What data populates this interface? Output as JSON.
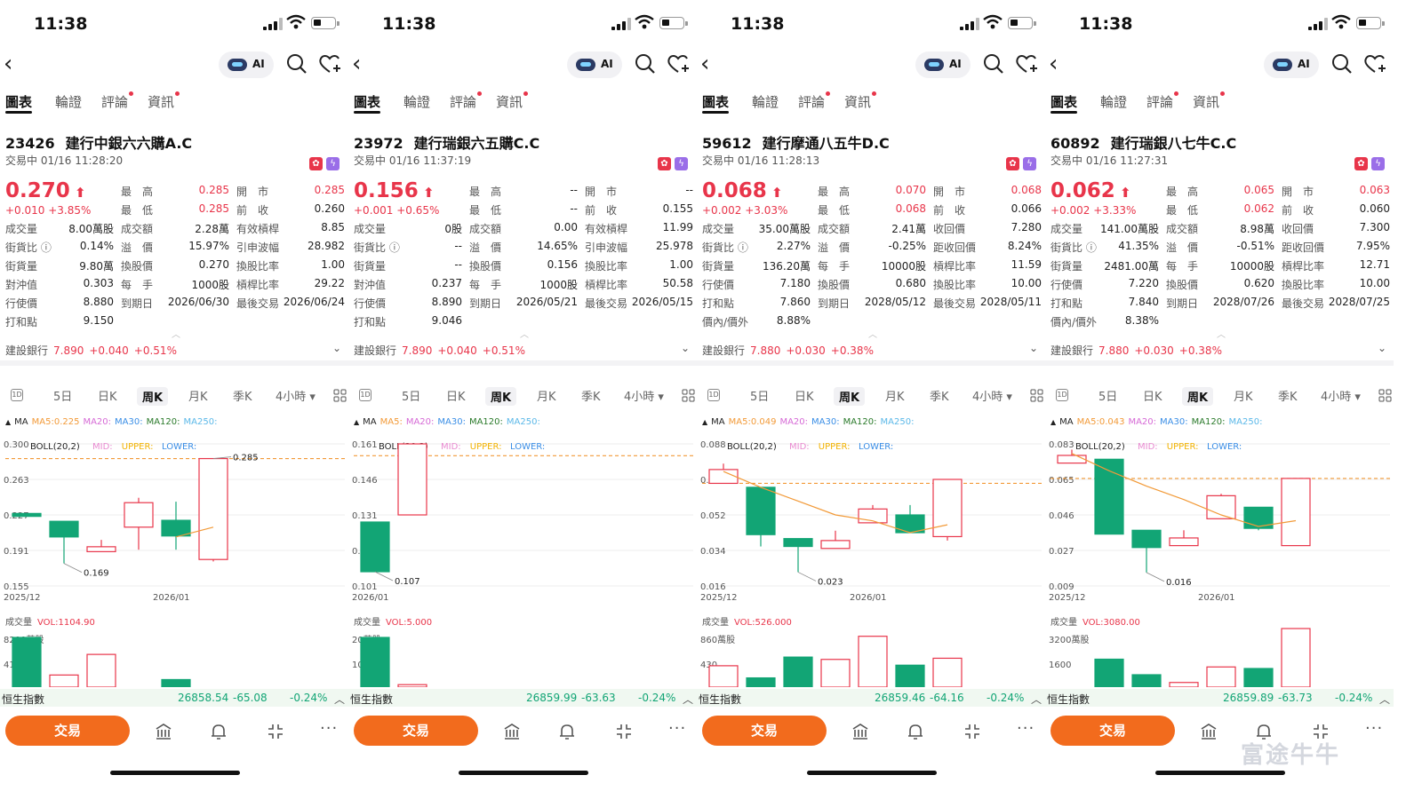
{
  "screens": [
    {
      "time": "11:38",
      "tabs": [
        "圖表",
        "輪證",
        "評論",
        "資訊"
      ],
      "code": "23426",
      "name": "建行中銀六六購A.C",
      "status": "交易中 01/16 11:28:20",
      "price": "0.270",
      "change": "+0.010 +3.85%",
      "quote_rows": [
        [
          "最　高",
          "0.285",
          "開　市",
          "0.285"
        ],
        [
          "最　低",
          "0.285",
          "前　收",
          "0.260"
        ],
        [
          "成交額",
          "2.28萬",
          "有效槓桿",
          "8.85"
        ],
        [
          "溢　價",
          "15.97%",
          "引申波幅",
          "28.982"
        ],
        [
          "換股價",
          "0.270",
          "換股比率",
          "1.00"
        ],
        [
          "每　手",
          "1000股",
          "槓桿比率",
          "29.22"
        ],
        [
          "到期日",
          "2026/06/30",
          "最後交易",
          "2026/06/24"
        ]
      ],
      "left_rows": [
        [
          "成交量",
          "8.00萬股"
        ],
        [
          "街貨比",
          "0.14%"
        ],
        [
          "街貨量",
          "9.80萬"
        ],
        [
          "對沖值",
          "0.303"
        ],
        [
          "行使價",
          "8.880"
        ],
        [
          "打和點",
          "9.150"
        ]
      ],
      "underlying": {
        "name": "建設銀行",
        "price": "7.890",
        "change": "+0.040",
        "pct": "+0.51%"
      },
      "periods": [
        "5日",
        "日K",
        "周K",
        "月K",
        "季K",
        "4小時"
      ],
      "ma_label": "MA",
      "ma_items": [
        [
          "MA5:0.225",
          "#f29a38"
        ],
        [
          "MA20:",
          "#d66ad6"
        ],
        [
          "MA30:",
          "#3a8ee6"
        ],
        [
          "MA120:",
          "#2a7a2a"
        ],
        [
          "MA250:",
          "#5bb8e8"
        ]
      ],
      "boll_items": [
        [
          "BOLL(20,2)",
          "#222"
        ],
        [
          "MID:",
          "#e88ad0"
        ],
        [
          "UPPER:",
          "#f2b200"
        ],
        [
          "LOWER:",
          "#3a8ee6"
        ]
      ],
      "chart_data": {
        "type": "candlestick",
        "y_ticks": [
          "0.300",
          "0.263",
          "0.227",
          "0.191",
          "0.155"
        ],
        "y_range": [
          0.155,
          0.3
        ],
        "x_labels": [
          "2025/12",
          "2026/01"
        ],
        "ref_line": 0.285,
        "candles": [
          {
            "o": 0.229,
            "c": 0.226,
            "h": 0.229,
            "l": 0.226,
            "up": false
          },
          {
            "o": 0.221,
            "c": 0.205,
            "h": 0.221,
            "l": 0.178,
            "up": false
          },
          {
            "o": 0.19,
            "c": 0.195,
            "h": 0.202,
            "l": 0.19,
            "up": true
          },
          {
            "o": 0.215,
            "c": 0.24,
            "h": 0.245,
            "l": 0.192,
            "up": true
          },
          {
            "o": 0.222,
            "c": 0.206,
            "h": 0.241,
            "l": 0.192,
            "up": false
          },
          {
            "o": 0.182,
            "c": 0.285,
            "h": 0.285,
            "l": 0.18,
            "up": true
          }
        ],
        "annotations": [
          {
            "candle": 5,
            "value": "0.285",
            "pos": "high"
          },
          {
            "candle": 1,
            "value": "0.169",
            "pos": "low"
          }
        ],
        "ma5": [
          null,
          null,
          null,
          null,
          0.205,
          0.215
        ]
      },
      "vol_label": "成交量",
      "vol_value": "VOL:1104.90",
      "vol_ticks": [
        "8200萬股",
        "4100"
      ],
      "volume": {
        "max": 8200,
        "bars": [
          [
            8200,
            false
          ],
          [
            2000,
            true
          ],
          [
            5400,
            true
          ],
          [
            0,
            false
          ],
          [
            1250,
            false
          ],
          [
            0,
            false
          ]
        ]
      },
      "hsi": {
        "name": "恒生指數",
        "value": "26858.54",
        "change": "-65.08",
        "pct": "-0.24%"
      },
      "trade_label": "交易"
    },
    {
      "time": "11:38",
      "tabs": [
        "圖表",
        "輪證",
        "評論",
        "資訊"
      ],
      "code": "23972",
      "name": "建行瑞銀六五購C.C",
      "status": "交易中 01/16 11:37:19",
      "price": "0.156",
      "change": "+0.001 +0.65%",
      "quote_rows": [
        [
          "最　高",
          "--",
          "開　市",
          "--"
        ],
        [
          "最　低",
          "--",
          "前　收",
          "0.155"
        ],
        [
          "成交額",
          "0.00",
          "有效槓桿",
          "11.99"
        ],
        [
          "溢　價",
          "14.65%",
          "引申波幅",
          "25.978"
        ],
        [
          "換股價",
          "0.156",
          "換股比率",
          "1.00"
        ],
        [
          "每　手",
          "1000股",
          "槓桿比率",
          "50.58"
        ],
        [
          "到期日",
          "2026/05/21",
          "最後交易",
          "2026/05/15"
        ]
      ],
      "left_rows": [
        [
          "成交量",
          "0股"
        ],
        [
          "街貨比",
          "--"
        ],
        [
          "街貨量",
          "--"
        ],
        [
          "對沖值",
          "0.237"
        ],
        [
          "行使價",
          "8.890"
        ],
        [
          "打和點",
          "9.046"
        ]
      ],
      "underlying": {
        "name": "建設銀行",
        "price": "7.890",
        "change": "+0.040",
        "pct": "+0.51%"
      },
      "periods": [
        "5日",
        "日K",
        "周K",
        "月K",
        "季K",
        "4小時"
      ],
      "ma_label": "MA",
      "ma_items": [
        [
          "MA5:",
          "#f29a38"
        ],
        [
          "MA20:",
          "#d66ad6"
        ],
        [
          "MA30:",
          "#3a8ee6"
        ],
        [
          "MA120:",
          "#2a7a2a"
        ],
        [
          "MA250:",
          "#5bb8e8"
        ]
      ],
      "boll_items": [
        [
          "BOLL(20,2)",
          "#222"
        ],
        [
          "MID:",
          "#e88ad0"
        ],
        [
          "UPPER:",
          "#f2b200"
        ],
        [
          "LOWER:",
          "#3a8ee6"
        ]
      ],
      "chart_data": {
        "type": "candlestick",
        "y_ticks": [
          "0.161",
          "0.146",
          "0.131",
          "0.116",
          "0.101"
        ],
        "y_range": [
          0.101,
          0.161
        ],
        "x_labels": [
          "2026/01"
        ],
        "ref_line": 0.156,
        "candles": [
          {
            "o": 0.128,
            "c": 0.107,
            "h": 0.128,
            "l": 0.107,
            "up": false
          },
          {
            "o": 0.131,
            "c": 0.161,
            "h": 0.161,
            "l": 0.131,
            "up": true
          }
        ],
        "annotations": [
          {
            "candle": 0,
            "value": "0.107",
            "pos": "low"
          }
        ],
        "ma5": []
      },
      "vol_label": "成交量",
      "vol_value": "VOL:5.000",
      "vol_ticks": [
        "20萬股",
        "10"
      ],
      "volume": {
        "max": 20,
        "bars": [
          [
            20,
            false
          ],
          [
            1,
            true
          ]
        ]
      },
      "hsi": {
        "name": "恒生指數",
        "value": "26859.99",
        "change": "-63.63",
        "pct": "-0.24%"
      },
      "trade_label": "交易"
    },
    {
      "time": "11:38",
      "tabs": [
        "圖表",
        "輪證",
        "評論",
        "資訊"
      ],
      "code": "59612",
      "name": "建行摩通八五牛D.C",
      "status": "交易中 01/16 11:28:13",
      "price": "0.068",
      "change": "+0.002 +3.03%",
      "quote_rows": [
        [
          "最　高",
          "0.070",
          "開　市",
          "0.068"
        ],
        [
          "最　低",
          "0.068",
          "前　收",
          "0.066"
        ],
        [
          "成交額",
          "2.41萬",
          "收回價",
          "7.280"
        ],
        [
          "溢　價",
          "-0.25%",
          "距收回價",
          "8.24%"
        ],
        [
          "每　手",
          "10000股",
          "槓桿比率",
          "11.59"
        ],
        [
          "換股價",
          "0.680",
          "換股比率",
          "10.00"
        ],
        [
          "到期日",
          "2028/05/12",
          "最後交易",
          "2028/05/11"
        ]
      ],
      "left_rows": [
        [
          "成交量",
          "35.00萬股"
        ],
        [
          "街貨比",
          "2.27%"
        ],
        [
          "街貨量",
          "136.20萬"
        ],
        [
          "行使價",
          "7.180"
        ],
        [
          "打和點",
          "7.860"
        ],
        [
          "價內/價外",
          "8.88%"
        ]
      ],
      "underlying": {
        "name": "建設銀行",
        "price": "7.880",
        "change": "+0.030",
        "pct": "+0.38%"
      },
      "periods": [
        "5日",
        "日K",
        "周K",
        "月K",
        "季K",
        "4小時"
      ],
      "ma_label": "MA",
      "ma_items": [
        [
          "MA5:0.049",
          "#f29a38"
        ],
        [
          "MA20:",
          "#d66ad6"
        ],
        [
          "MA30:",
          "#3a8ee6"
        ],
        [
          "MA120:",
          "#2a7a2a"
        ],
        [
          "MA250:",
          "#5bb8e8"
        ]
      ],
      "boll_items": [
        [
          "BOLL(20,2)",
          "#222"
        ],
        [
          "MID:",
          "#e88ad0"
        ],
        [
          "UPPER:",
          "#f2b200"
        ],
        [
          "LOWER:",
          "#3a8ee6"
        ]
      ],
      "chart_data": {
        "type": "candlestick",
        "y_ticks": [
          "0.088",
          "0.070",
          "0.052",
          "0.034",
          "0.016"
        ],
        "y_range": [
          0.016,
          0.088
        ],
        "x_labels": [
          "2025/12",
          "2026/01"
        ],
        "ref_line": 0.068,
        "candles": [
          {
            "o": 0.068,
            "c": 0.075,
            "h": 0.078,
            "l": 0.068,
            "up": true
          },
          {
            "o": 0.066,
            "c": 0.042,
            "h": 0.066,
            "l": 0.036,
            "up": false
          },
          {
            "o": 0.04,
            "c": 0.036,
            "h": 0.04,
            "l": 0.023,
            "up": false
          },
          {
            "o": 0.035,
            "c": 0.039,
            "h": 0.044,
            "l": 0.035,
            "up": true
          },
          {
            "o": 0.048,
            "c": 0.055,
            "h": 0.057,
            "l": 0.048,
            "up": true
          },
          {
            "o": 0.052,
            "c": 0.043,
            "h": 0.057,
            "l": 0.043,
            "up": false
          },
          {
            "o": 0.041,
            "c": 0.07,
            "h": 0.07,
            "l": 0.039,
            "up": true
          }
        ],
        "annotations": [
          {
            "candle": 2,
            "value": "0.023",
            "pos": "low"
          }
        ],
        "ma5": [
          0.074,
          0.066,
          0.059,
          0.052,
          0.049,
          0.043,
          0.047
        ]
      },
      "vol_label": "成交量",
      "vol_value": "VOL:526.000",
      "vol_ticks": [
        "860萬股",
        "430"
      ],
      "volume": {
        "max": 860,
        "bars": [
          [
            370,
            true
          ],
          [
            160,
            false
          ],
          [
            520,
            false
          ],
          [
            480,
            true
          ],
          [
            880,
            true
          ],
          [
            380,
            false
          ],
          [
            500,
            true
          ]
        ]
      },
      "hsi": {
        "name": "恒生指數",
        "value": "26859.46",
        "change": "-64.16",
        "pct": "-0.24%"
      },
      "trade_label": "交易"
    },
    {
      "time": "11:38",
      "tabs": [
        "圖表",
        "輪證",
        "評論",
        "資訊"
      ],
      "code": "60892",
      "name": "建行瑞銀八七牛C.C",
      "status": "交易中 01/16 11:27:31",
      "price": "0.062",
      "change": "+0.002 +3.33%",
      "quote_rows": [
        [
          "最　高",
          "0.065",
          "開　市",
          "0.063"
        ],
        [
          "最　低",
          "0.062",
          "前　收",
          "0.060"
        ],
        [
          "成交額",
          "8.98萬",
          "收回價",
          "7.300"
        ],
        [
          "溢　價",
          "-0.51%",
          "距收回價",
          "7.95%"
        ],
        [
          "每　手",
          "10000股",
          "槓桿比率",
          "12.71"
        ],
        [
          "換股價",
          "0.620",
          "換股比率",
          "10.00"
        ],
        [
          "到期日",
          "2028/07/26",
          "最後交易",
          "2028/07/25"
        ]
      ],
      "left_rows": [
        [
          "成交量",
          "141.00萬股"
        ],
        [
          "街貨比",
          "41.35%"
        ],
        [
          "街貨量",
          "2481.00萬"
        ],
        [
          "行使價",
          "7.220"
        ],
        [
          "打和點",
          "7.840"
        ],
        [
          "價內/價外",
          "8.38%"
        ]
      ],
      "underlying": {
        "name": "建設銀行",
        "price": "7.880",
        "change": "+0.030",
        "pct": "+0.38%"
      },
      "periods": [
        "5日",
        "日K",
        "周K",
        "月K",
        "季K",
        "4小時"
      ],
      "ma_label": "MA",
      "ma_items": [
        [
          "MA5:0.043",
          "#f29a38"
        ],
        [
          "MA20:",
          "#d66ad6"
        ],
        [
          "MA30:",
          "#3a8ee6"
        ],
        [
          "MA120:",
          "#2a7a2a"
        ],
        [
          "MA250:",
          "#5bb8e8"
        ]
      ],
      "boll_items": [
        [
          "BOLL(20,2)",
          "#222"
        ],
        [
          "MID:",
          "#e88ad0"
        ],
        [
          "UPPER:",
          "#f2b200"
        ],
        [
          "LOWER:",
          "#3a8ee6"
        ]
      ],
      "chart_data": {
        "type": "candlestick",
        "y_ticks": [
          "0.083",
          "0.065",
          "0.046",
          "0.027",
          "0.009"
        ],
        "y_range": [
          0.009,
          0.083
        ],
        "x_labels": [
          "2025/12",
          "2026/01"
        ],
        "ref_line": 0.065,
        "candles": [
          {
            "o": 0.073,
            "c": 0.077,
            "h": 0.08,
            "l": 0.073,
            "up": true
          },
          {
            "o": 0.075,
            "c": 0.036,
            "h": 0.075,
            "l": 0.036,
            "up": false
          },
          {
            "o": 0.038,
            "c": 0.029,
            "h": 0.038,
            "l": 0.016,
            "up": false
          },
          {
            "o": 0.03,
            "c": 0.034,
            "h": 0.038,
            "l": 0.03,
            "up": true
          },
          {
            "o": 0.044,
            "c": 0.056,
            "h": 0.057,
            "l": 0.044,
            "up": true
          },
          {
            "o": 0.05,
            "c": 0.039,
            "h": 0.05,
            "l": 0.038,
            "up": false
          },
          {
            "o": 0.03,
            "c": 0.065,
            "h": 0.065,
            "l": 0.03,
            "up": true
          }
        ],
        "annotations": [
          {
            "candle": 2,
            "value": "0.016",
            "pos": "low"
          }
        ],
        "ma5": [
          0.078,
          0.069,
          0.061,
          0.054,
          0.046,
          0.04,
          0.043
        ]
      },
      "vol_label": "成交量",
      "vol_value": "VOL:3080.00",
      "vol_ticks": [
        "3200萬股",
        "1600"
      ],
      "volume": {
        "max": 3200,
        "bars": [
          [
            0,
            true
          ],
          [
            1800,
            false
          ],
          [
            800,
            false
          ],
          [
            300,
            true
          ],
          [
            1300,
            true
          ],
          [
            1200,
            false
          ],
          [
            4000,
            true
          ]
        ]
      },
      "hsi": {
        "name": "恒生指數",
        "value": "26859.89",
        "change": "-63.73",
        "pct": "-0.24%"
      },
      "trade_label": "交易"
    }
  ],
  "watermark": "富途牛牛",
  "colors": {
    "up": "#e8354a",
    "down": "#12a575",
    "accent": "#f26b1d"
  }
}
